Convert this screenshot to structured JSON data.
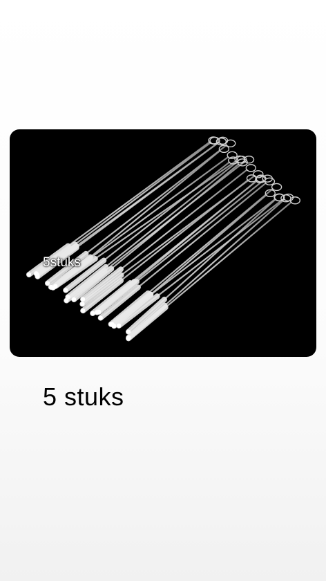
{
  "image": {
    "overlay_text": "5stuks",
    "subject": "stainless-steel-straw-cleaning-brushes",
    "background_color": "#000000"
  },
  "caption": {
    "text": "5 stuks"
  }
}
